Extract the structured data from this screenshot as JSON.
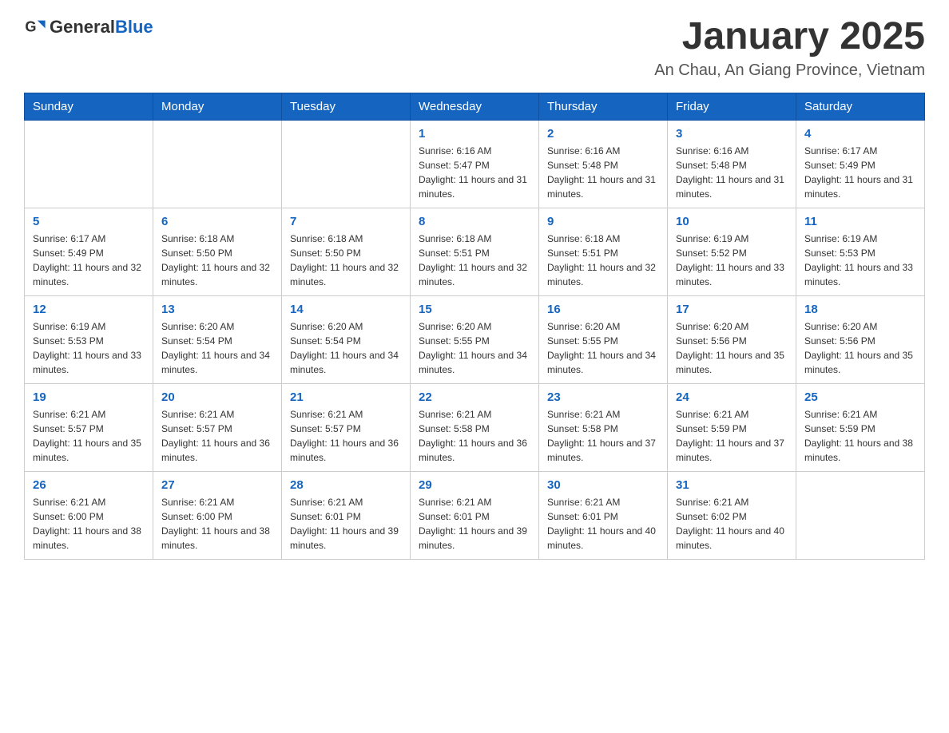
{
  "header": {
    "logo_general": "General",
    "logo_blue": "Blue",
    "month_title": "January 2025",
    "location": "An Chau, An Giang Province, Vietnam"
  },
  "days_of_week": [
    "Sunday",
    "Monday",
    "Tuesday",
    "Wednesday",
    "Thursday",
    "Friday",
    "Saturday"
  ],
  "weeks": [
    [
      {
        "day": "",
        "info": ""
      },
      {
        "day": "",
        "info": ""
      },
      {
        "day": "",
        "info": ""
      },
      {
        "day": "1",
        "info": "Sunrise: 6:16 AM\nSunset: 5:47 PM\nDaylight: 11 hours and 31 minutes."
      },
      {
        "day": "2",
        "info": "Sunrise: 6:16 AM\nSunset: 5:48 PM\nDaylight: 11 hours and 31 minutes."
      },
      {
        "day": "3",
        "info": "Sunrise: 6:16 AM\nSunset: 5:48 PM\nDaylight: 11 hours and 31 minutes."
      },
      {
        "day": "4",
        "info": "Sunrise: 6:17 AM\nSunset: 5:49 PM\nDaylight: 11 hours and 31 minutes."
      }
    ],
    [
      {
        "day": "5",
        "info": "Sunrise: 6:17 AM\nSunset: 5:49 PM\nDaylight: 11 hours and 32 minutes."
      },
      {
        "day": "6",
        "info": "Sunrise: 6:18 AM\nSunset: 5:50 PM\nDaylight: 11 hours and 32 minutes."
      },
      {
        "day": "7",
        "info": "Sunrise: 6:18 AM\nSunset: 5:50 PM\nDaylight: 11 hours and 32 minutes."
      },
      {
        "day": "8",
        "info": "Sunrise: 6:18 AM\nSunset: 5:51 PM\nDaylight: 11 hours and 32 minutes."
      },
      {
        "day": "9",
        "info": "Sunrise: 6:18 AM\nSunset: 5:51 PM\nDaylight: 11 hours and 32 minutes."
      },
      {
        "day": "10",
        "info": "Sunrise: 6:19 AM\nSunset: 5:52 PM\nDaylight: 11 hours and 33 minutes."
      },
      {
        "day": "11",
        "info": "Sunrise: 6:19 AM\nSunset: 5:53 PM\nDaylight: 11 hours and 33 minutes."
      }
    ],
    [
      {
        "day": "12",
        "info": "Sunrise: 6:19 AM\nSunset: 5:53 PM\nDaylight: 11 hours and 33 minutes."
      },
      {
        "day": "13",
        "info": "Sunrise: 6:20 AM\nSunset: 5:54 PM\nDaylight: 11 hours and 34 minutes."
      },
      {
        "day": "14",
        "info": "Sunrise: 6:20 AM\nSunset: 5:54 PM\nDaylight: 11 hours and 34 minutes."
      },
      {
        "day": "15",
        "info": "Sunrise: 6:20 AM\nSunset: 5:55 PM\nDaylight: 11 hours and 34 minutes."
      },
      {
        "day": "16",
        "info": "Sunrise: 6:20 AM\nSunset: 5:55 PM\nDaylight: 11 hours and 34 minutes."
      },
      {
        "day": "17",
        "info": "Sunrise: 6:20 AM\nSunset: 5:56 PM\nDaylight: 11 hours and 35 minutes."
      },
      {
        "day": "18",
        "info": "Sunrise: 6:20 AM\nSunset: 5:56 PM\nDaylight: 11 hours and 35 minutes."
      }
    ],
    [
      {
        "day": "19",
        "info": "Sunrise: 6:21 AM\nSunset: 5:57 PM\nDaylight: 11 hours and 35 minutes."
      },
      {
        "day": "20",
        "info": "Sunrise: 6:21 AM\nSunset: 5:57 PM\nDaylight: 11 hours and 36 minutes."
      },
      {
        "day": "21",
        "info": "Sunrise: 6:21 AM\nSunset: 5:57 PM\nDaylight: 11 hours and 36 minutes."
      },
      {
        "day": "22",
        "info": "Sunrise: 6:21 AM\nSunset: 5:58 PM\nDaylight: 11 hours and 36 minutes."
      },
      {
        "day": "23",
        "info": "Sunrise: 6:21 AM\nSunset: 5:58 PM\nDaylight: 11 hours and 37 minutes."
      },
      {
        "day": "24",
        "info": "Sunrise: 6:21 AM\nSunset: 5:59 PM\nDaylight: 11 hours and 37 minutes."
      },
      {
        "day": "25",
        "info": "Sunrise: 6:21 AM\nSunset: 5:59 PM\nDaylight: 11 hours and 38 minutes."
      }
    ],
    [
      {
        "day": "26",
        "info": "Sunrise: 6:21 AM\nSunset: 6:00 PM\nDaylight: 11 hours and 38 minutes."
      },
      {
        "day": "27",
        "info": "Sunrise: 6:21 AM\nSunset: 6:00 PM\nDaylight: 11 hours and 38 minutes."
      },
      {
        "day": "28",
        "info": "Sunrise: 6:21 AM\nSunset: 6:01 PM\nDaylight: 11 hours and 39 minutes."
      },
      {
        "day": "29",
        "info": "Sunrise: 6:21 AM\nSunset: 6:01 PM\nDaylight: 11 hours and 39 minutes."
      },
      {
        "day": "30",
        "info": "Sunrise: 6:21 AM\nSunset: 6:01 PM\nDaylight: 11 hours and 40 minutes."
      },
      {
        "day": "31",
        "info": "Sunrise: 6:21 AM\nSunset: 6:02 PM\nDaylight: 11 hours and 40 minutes."
      },
      {
        "day": "",
        "info": ""
      }
    ]
  ]
}
